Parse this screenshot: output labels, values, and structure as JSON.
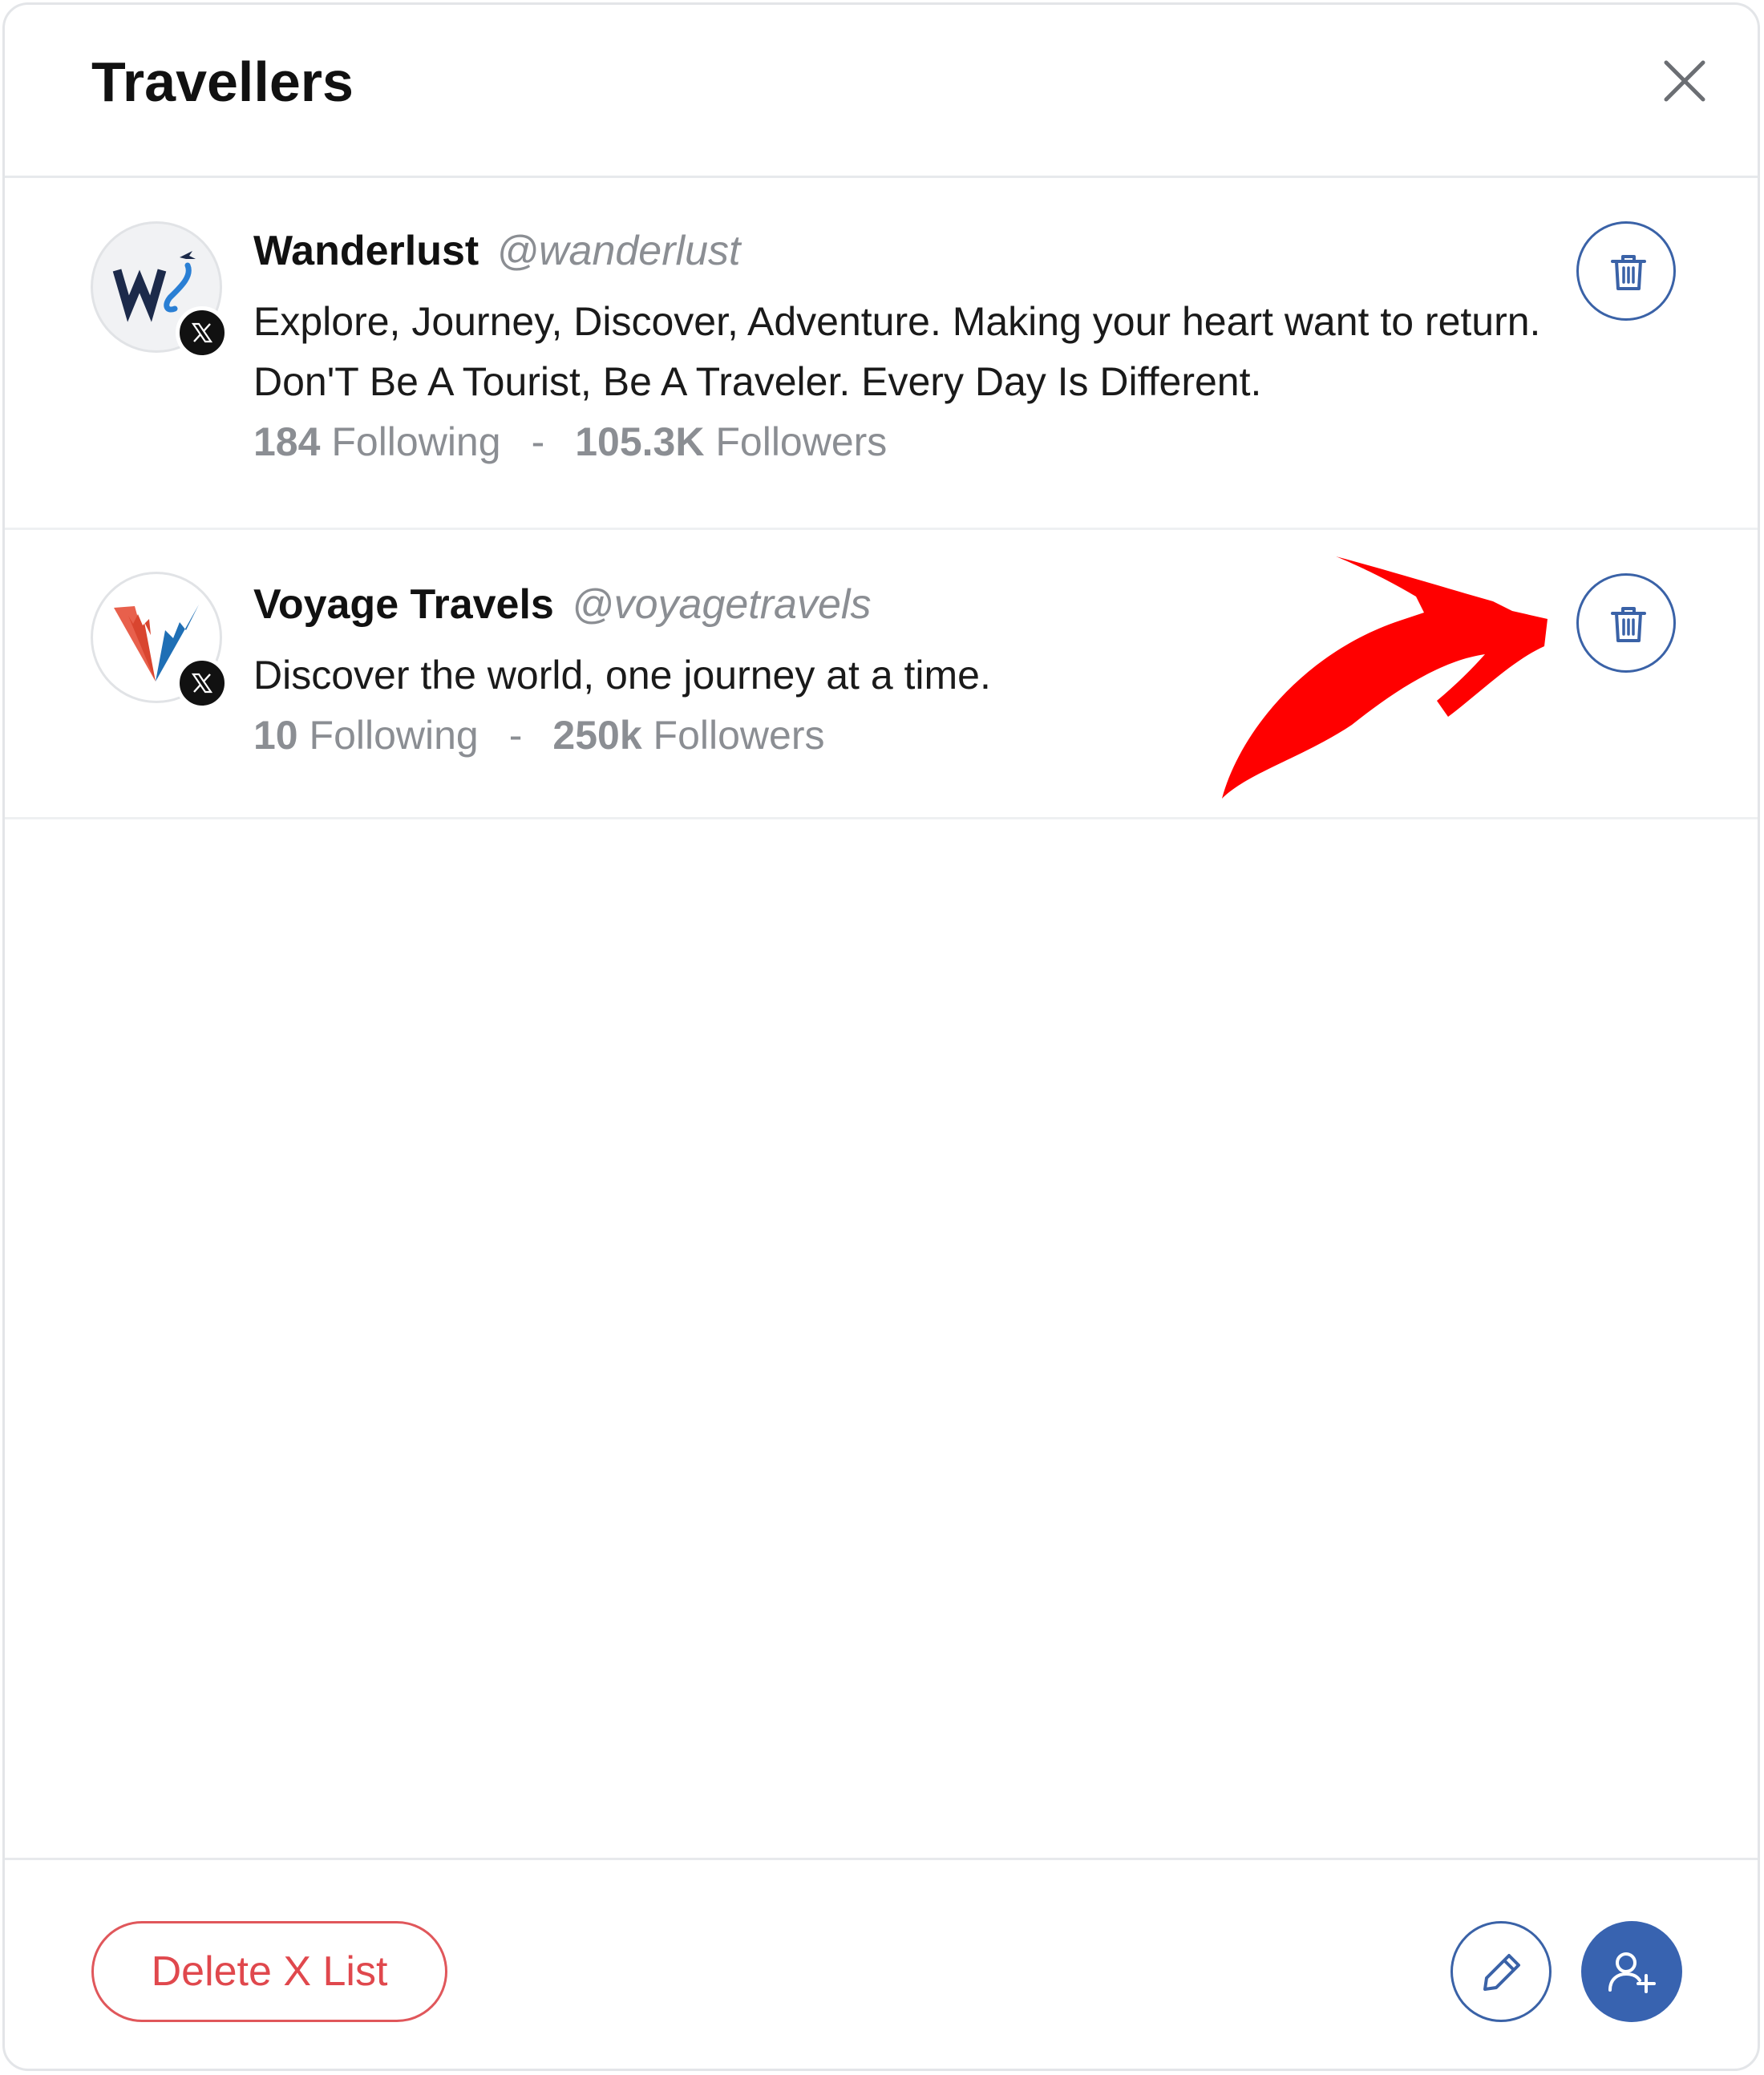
{
  "dialog": {
    "title": "Travellers",
    "close_icon": "close-icon"
  },
  "members": [
    {
      "name": "Wanderlust",
      "handle": "@wanderlust",
      "bio": "Explore, Journey, Discover, Adventure. Making your heart want to return. Don'T Be A Tourist, Be A Traveler. Every Day Is Different.",
      "following_count": "184",
      "following_label": "Following",
      "separator": "-",
      "followers_count": "105.3K",
      "followers_label": "Followers",
      "network_icon": "x-logo-icon",
      "action_icon": "trash-icon"
    },
    {
      "name": "Voyage Travels",
      "handle": "@voyagetravels",
      "bio": "Discover the world, one journey at a time.",
      "following_count": "10",
      "following_label": "Following",
      "separator": "-",
      "followers_count": "250k",
      "followers_label": "Followers",
      "network_icon": "x-logo-icon",
      "action_icon": "trash-icon"
    }
  ],
  "footer": {
    "delete_list_label": "Delete X List",
    "edit_icon": "pencil-icon",
    "add_user_icon": "add-user-icon"
  },
  "colors": {
    "accent_blue": "#3863b0",
    "danger_red": "#e0484d",
    "annotation_red": "#ff0000",
    "muted_text": "#8b8e93"
  }
}
